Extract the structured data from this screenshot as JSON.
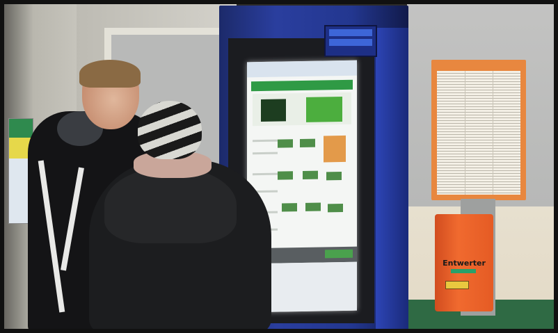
{
  "photo": {
    "validator_text": "Entwerter"
  },
  "colors": {
    "kiosk": "#2a3e9e",
    "screen_header": "#2f9a45",
    "notice_board": "#e8873f",
    "validator": "#f06a2f"
  }
}
